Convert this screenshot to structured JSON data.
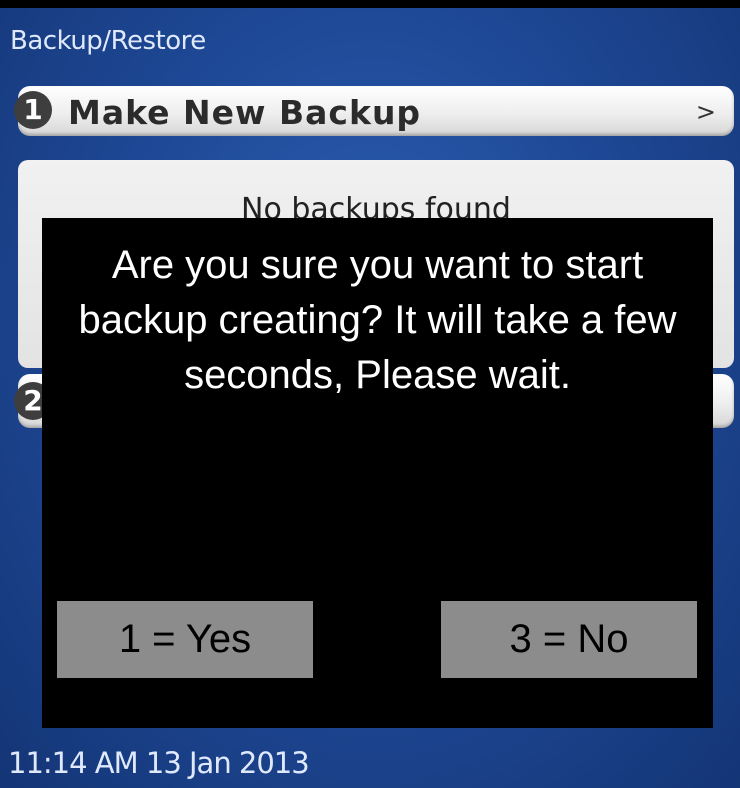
{
  "screen": {
    "title": "Backup/Restore",
    "menu": [
      {
        "number": "1",
        "label": "Make New Backup",
        "chevron": ">"
      },
      {
        "number": "2",
        "label": "",
        "chevron": ""
      }
    ],
    "list_empty_text": "No backups found",
    "status_bar": "11:14 AM 13 Jan 2013"
  },
  "dialog": {
    "message": "Are you sure you want to start backup creating? It will take a few seconds, Please wait.",
    "yes_label": "1 = Yes",
    "no_label": "3 = No"
  },
  "colors": {
    "background": "#1f4a98",
    "dialog_bg": "#000000",
    "dialog_button_bg": "#8c8c8c"
  }
}
